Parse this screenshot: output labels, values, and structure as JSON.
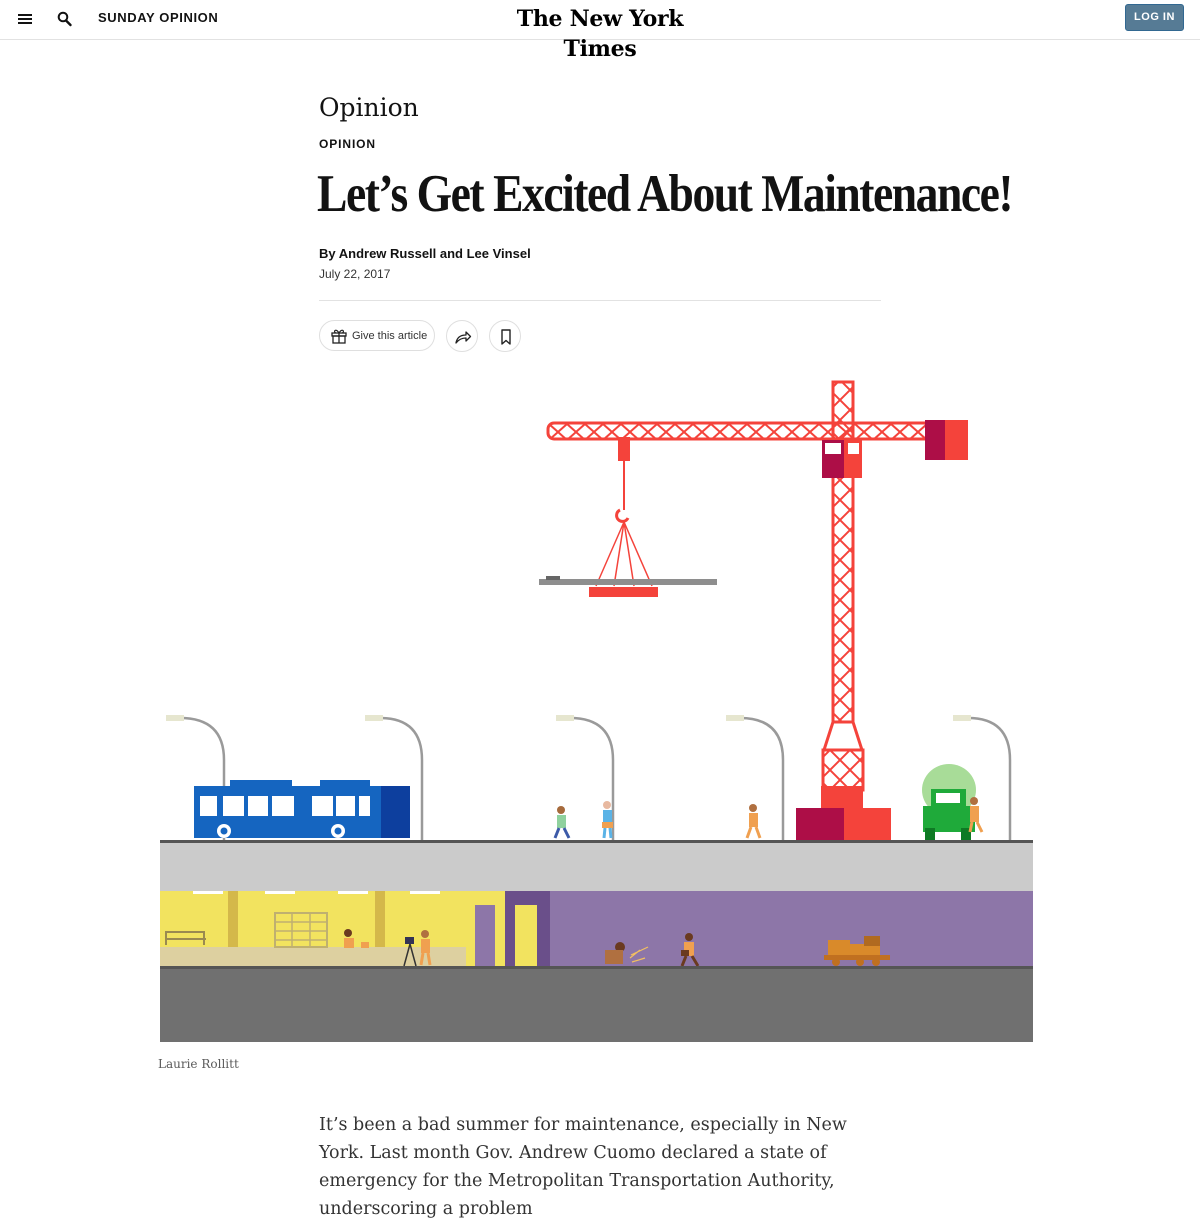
{
  "header": {
    "section_label": "SUNDAY OPINION",
    "logo_text": "The New York Times",
    "login_label": "LOG IN"
  },
  "article": {
    "kicker": "Opinion",
    "label": "OPINION",
    "headline": "Let’s Get Excited About Maintenance!",
    "byline": "By Andrew Russell and Lee Vinsel",
    "date": "July 22, 2017",
    "gift_label": "Give this article",
    "image_credit": "Laurie Rollitt",
    "body_paragraph": "It’s been a bad summer for maintenance, especially in New York. Last month Gov. Andrew Cuomo declared a state of emergency for the Metropolitan Transportation Authority, underscoring a problem"
  },
  "icons": {
    "menu": "hamburger-icon",
    "search": "search-icon",
    "gift": "gift-icon",
    "share": "share-icon",
    "save": "bookmark-icon"
  },
  "colors": {
    "login_button": "#567b95",
    "crane": "#f4433b",
    "bus": "#1565c0",
    "tunnel_yellow": "#f2e35f",
    "tunnel_purple": "#8d76a8",
    "road": "#cbcbcb",
    "ground": "#707070"
  }
}
